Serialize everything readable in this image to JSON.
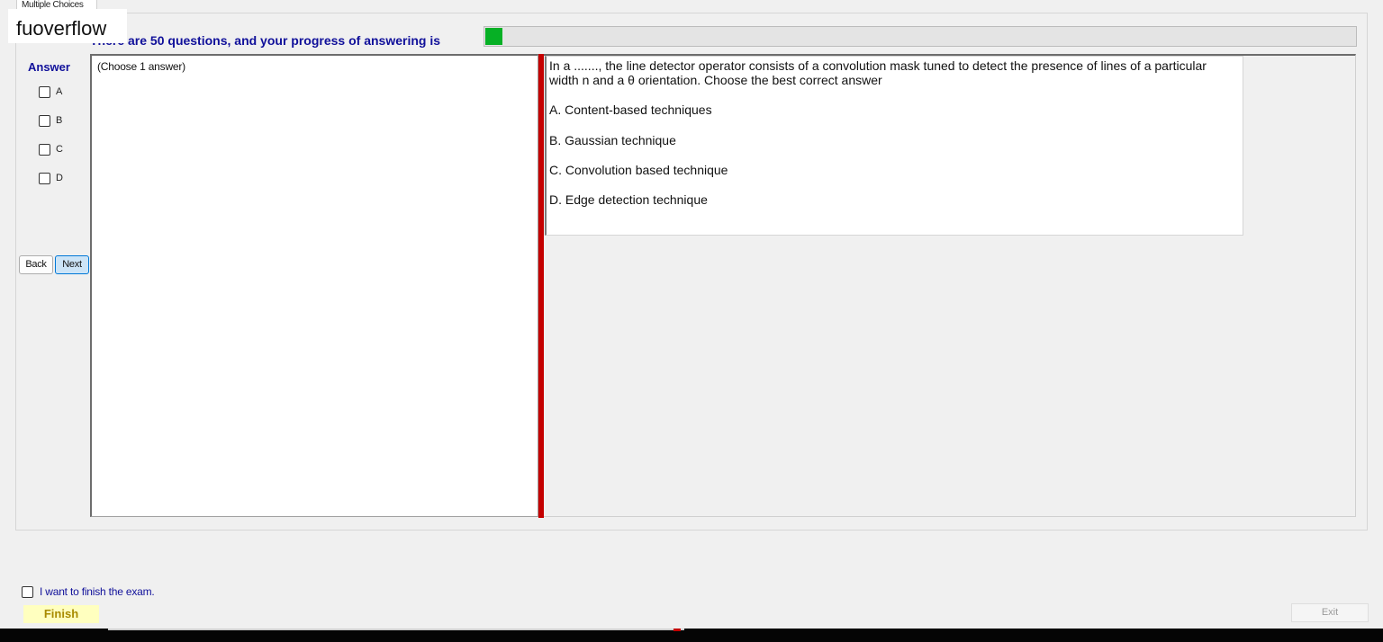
{
  "tab": {
    "label": "Multiple Choices"
  },
  "watermark": {
    "text": "fuoverflow"
  },
  "progress": {
    "text": "There are 50 questions, and your progress of answering is",
    "fraction": 0.02,
    "color": "#06b025"
  },
  "answer": {
    "heading": "Answer",
    "options": [
      {
        "label": "A"
      },
      {
        "label": "B"
      },
      {
        "label": "C"
      },
      {
        "label": "D"
      }
    ]
  },
  "nav": {
    "back_label": "Back",
    "next_label": "Next"
  },
  "answer_panel": {
    "hint": "(Choose 1 answer)"
  },
  "question": {
    "text": "In a ......., the line detector operator consists of a convolution mask tuned to detect the presence of lines of a particular width n and a θ orientation. Choose the best correct answer",
    "options": [
      "A.  Content-based techniques",
      "B.  Gaussian technique",
      "C.  Convolution based technique",
      "D.  Edge detection technique"
    ]
  },
  "finish": {
    "checkbox_label": "I want to finish the exam.",
    "button_label": "Finish"
  },
  "exit": {
    "label": "Exit"
  },
  "colors": {
    "heading": "#10109a",
    "splitter": "#c40000",
    "finish_bg": "#ffffbf"
  }
}
